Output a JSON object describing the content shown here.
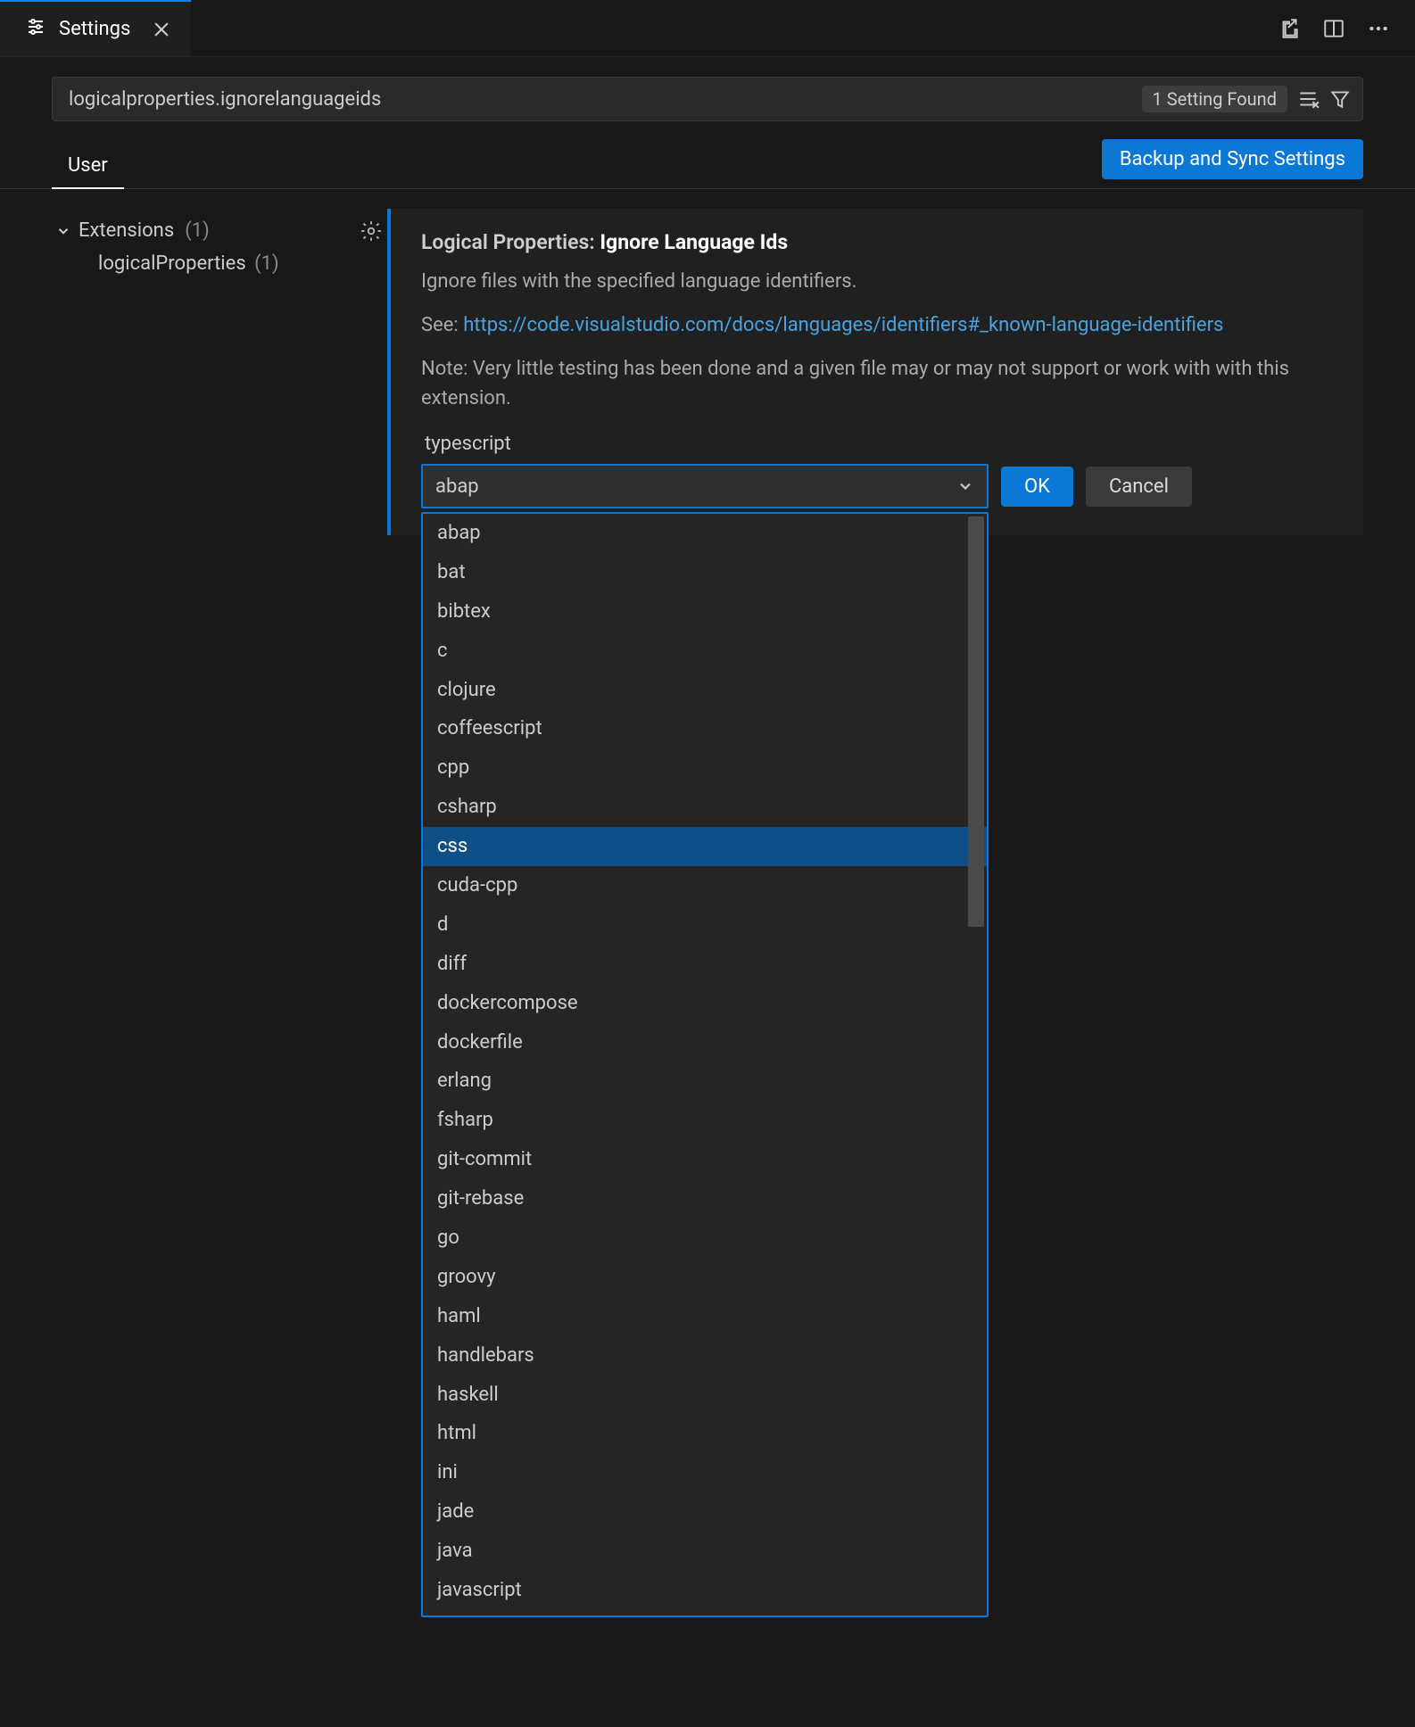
{
  "tab": {
    "label": "Settings"
  },
  "search": {
    "value": "logicalproperties.ignorelanguageids",
    "badge": "1 Setting Found"
  },
  "scope": {
    "user": "User",
    "sync_btn": "Backup and Sync Settings"
  },
  "toc": {
    "group_label": "Extensions",
    "group_count": "(1)",
    "child_label": "logicalProperties",
    "child_count": "(1)"
  },
  "setting": {
    "title_prefix": "Logical Properties: ",
    "title_name": "Ignore Language Ids",
    "desc1": "Ignore files with the specified language identifiers.",
    "desc_see": "See: ",
    "desc_link": "https://code.visualstudio.com/docs/languages/identifiers#_known-language-identifiers",
    "desc_note": "Note: Very little testing has been done and a given file may or may not support or work with with this extension.",
    "last_item": "typescript",
    "combo_value": "abap",
    "ok_label": "OK",
    "cancel_label": "Cancel"
  },
  "dropdown": {
    "highlighted": "css",
    "items": [
      "abap",
      "bat",
      "bibtex",
      "c",
      "clojure",
      "coffeescript",
      "cpp",
      "csharp",
      "css",
      "cuda-cpp",
      "d",
      "diff",
      "dockercompose",
      "dockerfile",
      "erlang",
      "fsharp",
      "git-commit",
      "git-rebase",
      "go",
      "groovy",
      "haml",
      "handlebars",
      "haskell",
      "html",
      "ini",
      "jade",
      "java",
      "javascript"
    ]
  }
}
